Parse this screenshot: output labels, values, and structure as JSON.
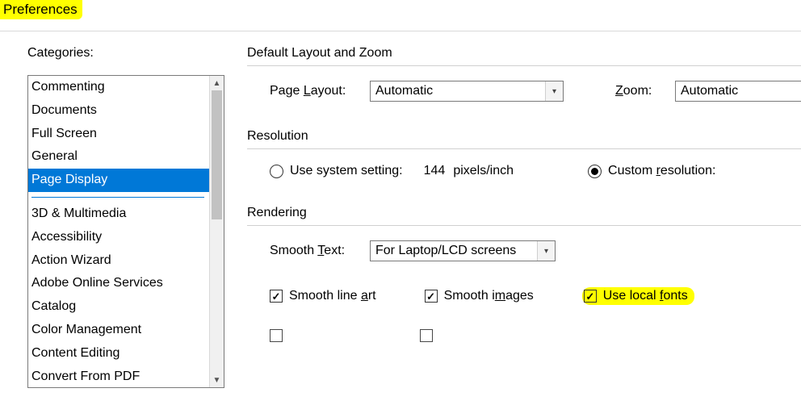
{
  "title": "Preferences",
  "sidebar": {
    "label": "Categories:",
    "items_top": [
      "Commenting",
      "Documents",
      "Full Screen",
      "General",
      "Page Display"
    ],
    "selected_index": 4,
    "items_bottom": [
      "3D & Multimedia",
      "Accessibility",
      "Action Wizard",
      "Adobe Online Services",
      "Catalog",
      "Color Management",
      "Content Editing",
      "Convert From PDF"
    ]
  },
  "layout_zoom": {
    "title": "Default Layout and Zoom",
    "page_layout_label_pre": "Page ",
    "page_layout_label_u": "L",
    "page_layout_label_post": "ayout:",
    "page_layout_value": "Automatic",
    "zoom_label_pre": "",
    "zoom_label_u": "Z",
    "zoom_label_post": "oom:",
    "zoom_value": "Automatic"
  },
  "resolution": {
    "title": "Resolution",
    "use_system_label": "Use system setting:",
    "value": "144",
    "units": "pixels/inch",
    "custom_label_pre": "Custom ",
    "custom_label_u": "r",
    "custom_label_post": "esolution:",
    "selected": "custom"
  },
  "rendering": {
    "title": "Rendering",
    "smooth_text_label_pre": "Smooth ",
    "smooth_text_label_u": "T",
    "smooth_text_label_post": "ext:",
    "smooth_text_value": "For Laptop/LCD screens",
    "smooth_line_art_pre": "Smooth line ",
    "smooth_line_art_u": "a",
    "smooth_line_art_post": "rt",
    "smooth_images_pre": "Smooth i",
    "smooth_images_u": "m",
    "smooth_images_post": "ages",
    "use_local_fonts_pre": "Use local ",
    "use_local_fonts_u": "f",
    "use_local_fonts_post": "onts"
  }
}
